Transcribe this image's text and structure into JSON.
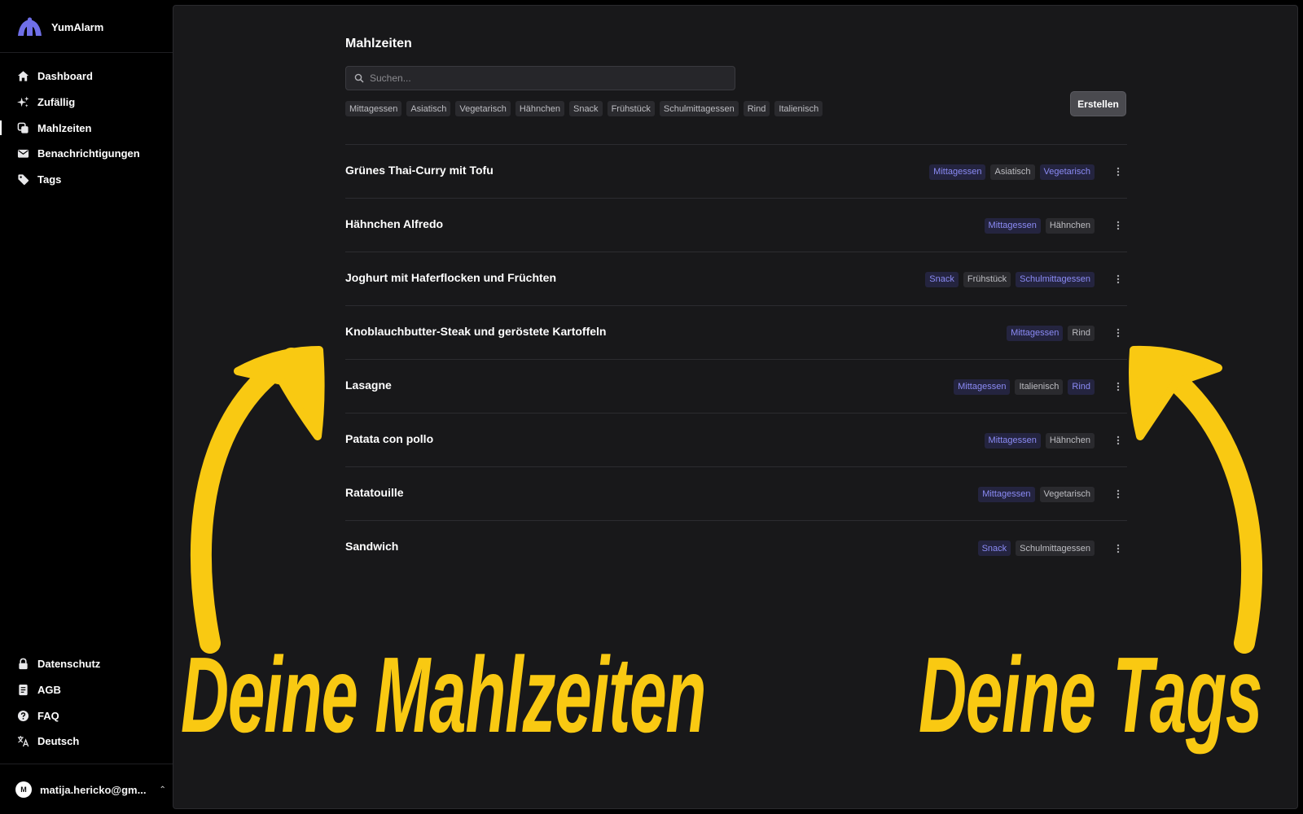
{
  "app": {
    "name": "YumAlarm",
    "accent": "#7b7bf0"
  },
  "nav": [
    {
      "label": "Dashboard",
      "icon": "home-icon"
    },
    {
      "label": "Zufällig",
      "icon": "sparkles-icon"
    },
    {
      "label": "Mahlzeiten",
      "icon": "copy-icon",
      "active": true
    },
    {
      "label": "Benachrichtigungen",
      "icon": "mail-icon"
    },
    {
      "label": "Tags",
      "icon": "tag-icon"
    }
  ],
  "nav_bottom": [
    {
      "label": "Datenschutz",
      "icon": "lock-icon"
    },
    {
      "label": "AGB",
      "icon": "document-icon"
    },
    {
      "label": "FAQ",
      "icon": "help-icon"
    },
    {
      "label": "Deutsch",
      "icon": "translate-icon"
    }
  ],
  "user": {
    "initial": "M",
    "email": "matija.hericko@gm..."
  },
  "page": {
    "title": "Mahlzeiten",
    "search_placeholder": "Suchen...",
    "create_label": "Erstellen",
    "filters": [
      "Mittagessen",
      "Asiatisch",
      "Vegetarisch",
      "Hähnchen",
      "Snack",
      "Frühstück",
      "Schulmittagessen",
      "Rind",
      "Italienisch"
    ]
  },
  "meals": [
    {
      "name": "Grünes Thai-Curry mit Tofu",
      "tags": [
        {
          "label": "Mittagessen",
          "accent": true
        },
        {
          "label": "Asiatisch",
          "accent": false
        },
        {
          "label": "Vegetarisch",
          "accent": true
        }
      ]
    },
    {
      "name": "Hähnchen Alfredo",
      "tags": [
        {
          "label": "Mittagessen",
          "accent": true
        },
        {
          "label": "Hähnchen",
          "accent": false
        }
      ]
    },
    {
      "name": "Joghurt mit Haferflocken und Früchten",
      "tags": [
        {
          "label": "Snack",
          "accent": true
        },
        {
          "label": "Frühstück",
          "accent": false
        },
        {
          "label": "Schulmittagessen",
          "accent": true
        }
      ]
    },
    {
      "name": "Knoblauchbutter-Steak und geröstete Kartoffeln",
      "tags": [
        {
          "label": "Mittagessen",
          "accent": true
        },
        {
          "label": "Rind",
          "accent": false
        }
      ]
    },
    {
      "name": "Lasagne",
      "tags": [
        {
          "label": "Mittagessen",
          "accent": true
        },
        {
          "label": "Italienisch",
          "accent": false
        },
        {
          "label": "Rind",
          "accent": true
        }
      ]
    },
    {
      "name": "Patata con pollo",
      "tags": [
        {
          "label": "Mittagessen",
          "accent": true
        },
        {
          "label": "Hähnchen",
          "accent": false
        }
      ]
    },
    {
      "name": "Ratatouille",
      "tags": [
        {
          "label": "Mittagessen",
          "accent": true
        },
        {
          "label": "Vegetarisch",
          "accent": false
        }
      ]
    },
    {
      "name": "Sandwich",
      "tags": [
        {
          "label": "Snack",
          "accent": true
        },
        {
          "label": "Schulmittagessen",
          "accent": false
        }
      ]
    }
  ],
  "annotations": {
    "left_text": "Deine Mahlzeiten",
    "right_text": "Deine Tags",
    "color": "#f9c912"
  }
}
